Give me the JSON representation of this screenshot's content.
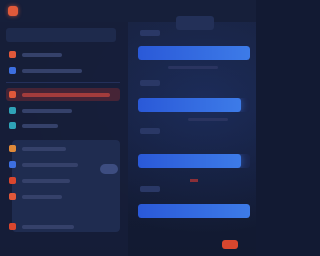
{
  "header": {
    "title": "",
    "button_label": ""
  },
  "sidebar": {
    "items": [
      {
        "icon": "square-icon",
        "color": "#e0583a"
      },
      {
        "icon": "square-icon",
        "color": "#3d6fe0"
      },
      {
        "icon": "square-icon",
        "color": "#e0583a"
      },
      {
        "icon": "square-icon",
        "color": "#2fa3b8"
      },
      {
        "icon": "square-icon",
        "color": "#2fa3b8"
      },
      {
        "icon": "square-icon",
        "color": "#e08a3a"
      },
      {
        "icon": "square-icon",
        "color": "#3d6fe0"
      },
      {
        "icon": "square-icon",
        "color": "#d9462e"
      },
      {
        "icon": "square-icon",
        "color": "#e0583a"
      },
      {
        "icon": "square-icon",
        "color": "#d9462e"
      }
    ],
    "active_index": 2
  },
  "main": {
    "progress_rows": [
      {
        "fill": 1.0
      },
      {
        "fill": 0.92
      },
      {
        "fill": 0.92
      },
      {
        "fill": 1.0
      }
    ]
  },
  "colors": {
    "accent_blue": "#3d7be8",
    "accent_red": "#d9462e",
    "background": "#121a33"
  }
}
